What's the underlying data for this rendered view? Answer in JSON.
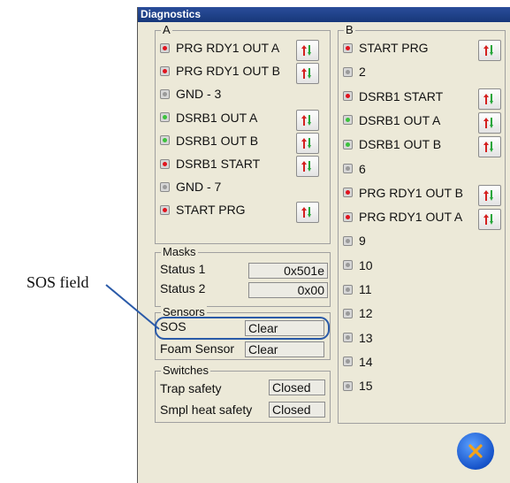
{
  "window": {
    "title": "Diagnostics"
  },
  "groupA": {
    "label": "A",
    "items": [
      {
        "label": "PRG RDY1 OUT A",
        "led": "#e0141e",
        "has_toggle": true
      },
      {
        "label": "PRG RDY1 OUT B",
        "led": "#e0141e",
        "has_toggle": true
      },
      {
        "label": "GND - 3",
        "led": "#9a9a9a",
        "has_toggle": false
      },
      {
        "label": "DSRB1 OUT A",
        "led": "#3cc23c",
        "has_toggle": true
      },
      {
        "label": "DSRB1 OUT B",
        "led": "#3cc23c",
        "has_toggle": true
      },
      {
        "label": "DSRB1 START",
        "led": "#e0141e",
        "has_toggle": true
      },
      {
        "label": "GND - 7",
        "led": "#9a9a9a",
        "has_toggle": false
      },
      {
        "label": "START PRG",
        "led": "#e0141e",
        "has_toggle": true
      }
    ]
  },
  "groupB": {
    "label": "B",
    "items": [
      {
        "label": "START PRG",
        "led": "#e0141e",
        "has_toggle": true
      },
      {
        "label": "2",
        "led": "#9a9a9a",
        "has_toggle": false
      },
      {
        "label": "DSRB1 START",
        "led": "#e0141e",
        "has_toggle": true
      },
      {
        "label": "DSRB1 OUT A",
        "led": "#3cc23c",
        "has_toggle": true
      },
      {
        "label": "DSRB1 OUT B",
        "led": "#3cc23c",
        "has_toggle": true
      },
      {
        "label": "6",
        "led": "#9a9a9a",
        "has_toggle": false
      },
      {
        "label": "PRG RDY1 OUT B",
        "led": "#e0141e",
        "has_toggle": true
      },
      {
        "label": "PRG RDY1 OUT A",
        "led": "#e0141e",
        "has_toggle": true
      },
      {
        "label": "9",
        "led": "#9a9a9a",
        "has_toggle": false
      },
      {
        "label": "10",
        "led": "#9a9a9a",
        "has_toggle": false
      },
      {
        "label": "11",
        "led": "#9a9a9a",
        "has_toggle": false
      },
      {
        "label": "12",
        "led": "#9a9a9a",
        "has_toggle": false
      },
      {
        "label": "13",
        "led": "#9a9a9a",
        "has_toggle": false
      },
      {
        "label": "14",
        "led": "#9a9a9a",
        "has_toggle": false
      },
      {
        "label": "15",
        "led": "#9a9a9a",
        "has_toggle": false
      }
    ]
  },
  "masks": {
    "label": "Masks",
    "status1_label": "Status 1",
    "status1_value": "0x501e",
    "status2_label": "Status 2",
    "status2_value": "0x00"
  },
  "sensors": {
    "label": "Sensors",
    "sos_label": "SOS",
    "sos_value": "Clear",
    "foam_label": "Foam Sensor",
    "foam_value": "Clear"
  },
  "switches": {
    "label": "Switches",
    "trap_label": "Trap safety",
    "trap_value": "Closed",
    "smpl_label": "Smpl heat safety",
    "smpl_value": "Closed"
  },
  "toggle_icon": "up-down-arrows-icon",
  "close_icon": "close-x-icon",
  "callout": {
    "text": "SOS field",
    "color": "#2a5aa8"
  }
}
